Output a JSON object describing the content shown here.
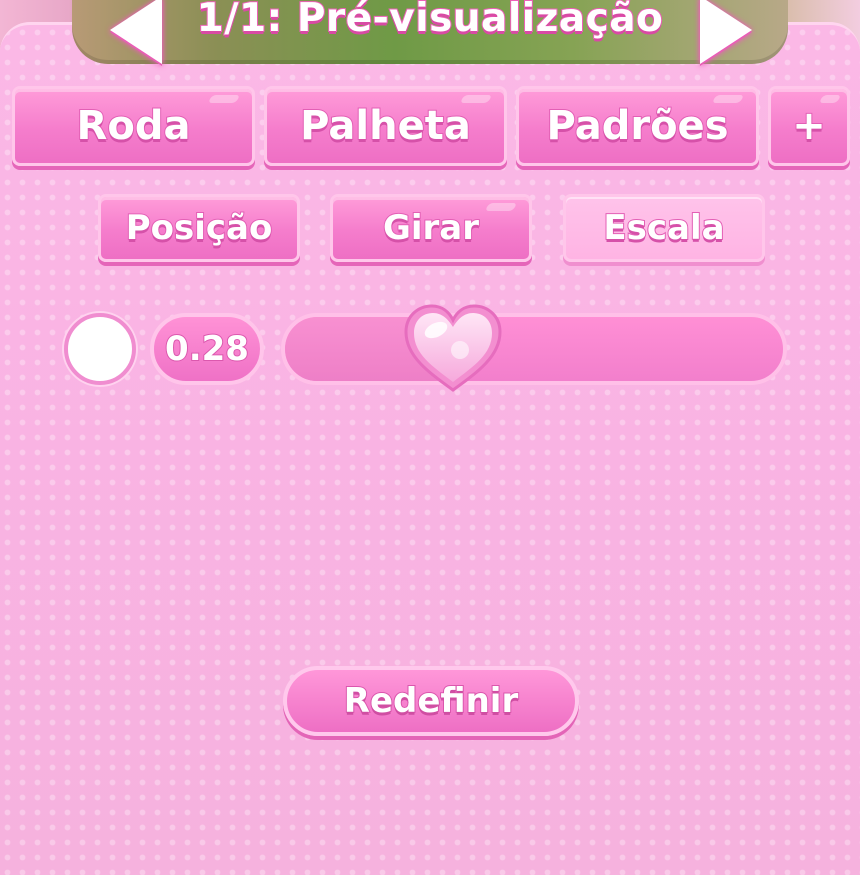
{
  "header": {
    "title": "1/1: Pré-visualização",
    "prev_icon": "arrow-left-icon",
    "next_icon": "arrow-right-icon"
  },
  "tabs": [
    {
      "label": "Roda"
    },
    {
      "label": "Palheta"
    },
    {
      "label": "Padrões"
    },
    {
      "label": "+"
    }
  ],
  "subtabs": [
    {
      "label": "Posição",
      "active": false
    },
    {
      "label": "Girar",
      "active": false
    },
    {
      "label": "Escala",
      "active": true
    }
  ],
  "slider": {
    "swatch_color": "#ffffff",
    "value_text": "0.28",
    "value": 0.28,
    "thumb_icon": "heart-icon"
  },
  "reset_label": "Redefinir",
  "colors": {
    "accent": "#f57dcc",
    "panel": "#f9b4e4",
    "outline": "#e35fb5"
  }
}
